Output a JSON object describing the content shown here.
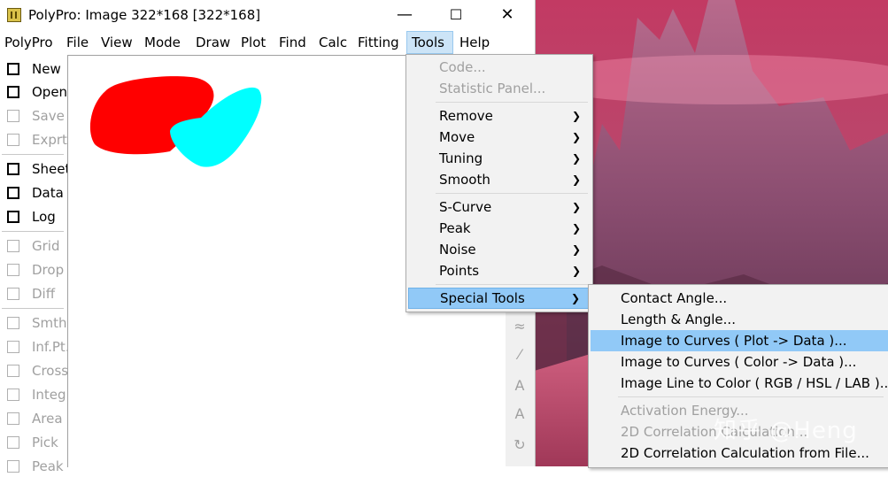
{
  "window": {
    "title": "PolyPro: Image 322*168 [322*168]",
    "controls": {
      "minimize": "—",
      "maximize": "☐",
      "close": "✕"
    }
  },
  "menubar": [
    "PolyPro",
    "File",
    "View",
    "Mode",
    "Draw",
    "Plot",
    "Find",
    "Calc",
    "Fitting",
    "Tools",
    "Help"
  ],
  "toolbar": [
    {
      "label": "New",
      "enabled": true
    },
    {
      "label": "Open",
      "enabled": true
    },
    {
      "label": "Save",
      "enabled": false
    },
    {
      "label": "Exprt",
      "enabled": false
    },
    {
      "label": "Sheet",
      "enabled": true
    },
    {
      "label": "Data",
      "enabled": true
    },
    {
      "label": "Log",
      "enabled": true
    },
    {
      "label": "Grid",
      "enabled": false
    },
    {
      "label": "Drop",
      "enabled": false
    },
    {
      "label": "Diff",
      "enabled": false
    },
    {
      "label": "Smth",
      "enabled": false
    },
    {
      "label": "Inf.Pt.",
      "enabled": false
    },
    {
      "label": "Cross",
      "enabled": false
    },
    {
      "label": "Integ",
      "enabled": false
    },
    {
      "label": "Area",
      "enabled": false
    },
    {
      "label": "Pick",
      "enabled": false
    },
    {
      "label": "Peak",
      "enabled": false
    }
  ],
  "tools_menu": {
    "items": [
      {
        "label": "Code...",
        "enabled": false,
        "submenu": false
      },
      {
        "label": "Statistic Panel...",
        "enabled": false,
        "submenu": false
      },
      {
        "label": "Remove",
        "enabled": true,
        "submenu": true
      },
      {
        "label": "Move",
        "enabled": true,
        "submenu": true
      },
      {
        "label": "Tuning",
        "enabled": true,
        "submenu": true
      },
      {
        "label": "Smooth",
        "enabled": true,
        "submenu": true
      },
      {
        "label": "S-Curve",
        "enabled": true,
        "submenu": true
      },
      {
        "label": "Peak",
        "enabled": true,
        "submenu": true
      },
      {
        "label": "Noise",
        "enabled": true,
        "submenu": true
      },
      {
        "label": "Points",
        "enabled": true,
        "submenu": true
      },
      {
        "label": "Special Tools",
        "enabled": true,
        "submenu": true,
        "highlighted": true
      }
    ]
  },
  "special_tools_submenu": [
    {
      "label": "Contact Angle...",
      "enabled": true
    },
    {
      "label": "Length & Angle...",
      "enabled": true
    },
    {
      "label": "Image to Curves ( Plot -> Data )...",
      "enabled": true,
      "highlighted": true
    },
    {
      "label": "Image to Curves ( Color -> Data )...",
      "enabled": true
    },
    {
      "label": "Image Line to Color ( RGB / HSL / LAB )...",
      "enabled": true
    },
    {
      "label": "Activation Energy...",
      "enabled": false
    },
    {
      "label": "2D Correlation Calculation...",
      "enabled": false
    },
    {
      "label": "2D Correlation Calculation from File...",
      "enabled": true
    }
  ],
  "watermark": "知乎 @Heng",
  "colors": {
    "red_blob": "#ff0000",
    "cyan_blob": "#00ffff",
    "highlight": "#91c9f7",
    "active_menu": "#cce4f7"
  }
}
